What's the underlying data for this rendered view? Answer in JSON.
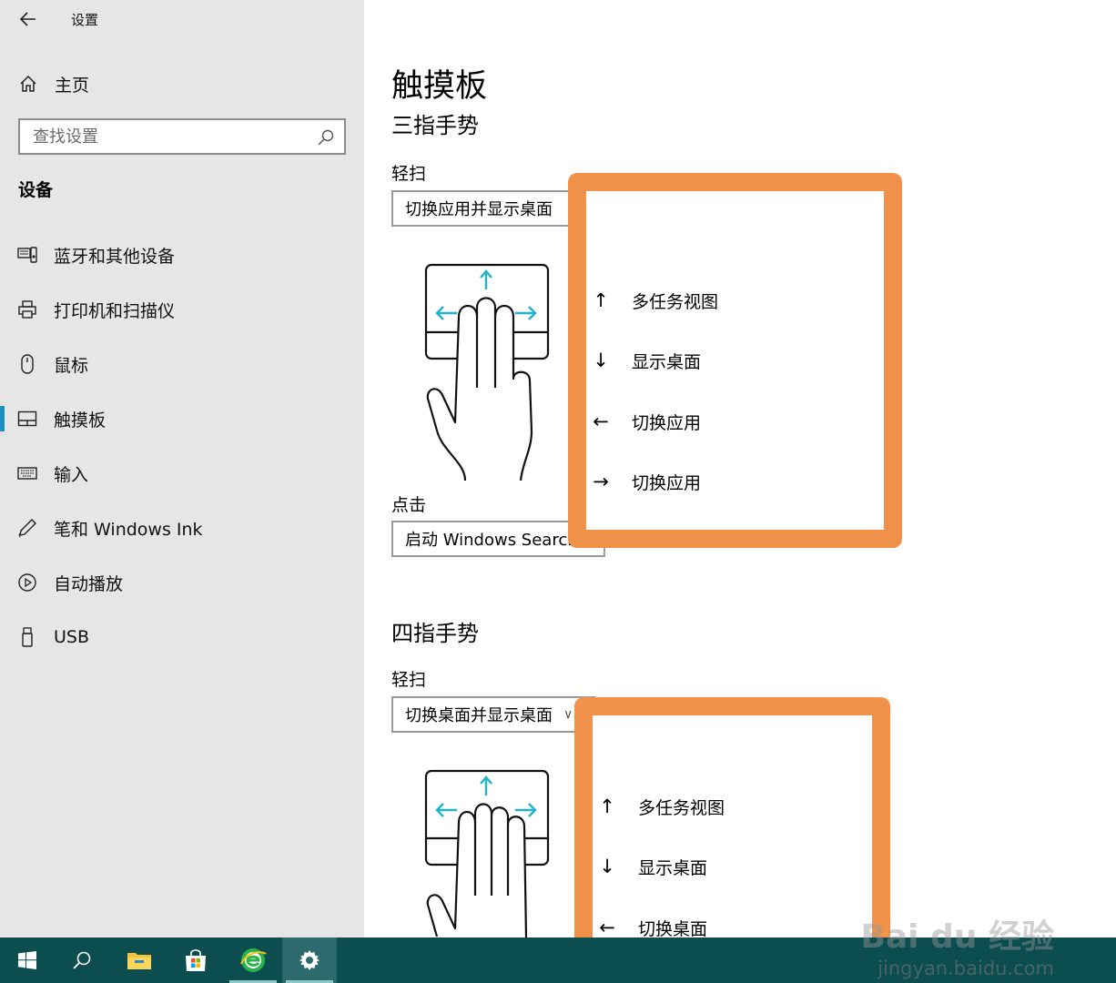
{
  "window": {
    "back_icon": "arrow-left-icon",
    "title": "设置"
  },
  "sidebar": {
    "home": {
      "icon": "home-icon",
      "label": "主页"
    },
    "search": {
      "placeholder": "查找设置",
      "icon": "search-icon"
    },
    "section_label": "设备",
    "items": [
      {
        "icon": "bluetooth-devices-icon",
        "label": "蓝牙和其他设备",
        "active": false
      },
      {
        "icon": "printer-icon",
        "label": "打印机和扫描仪",
        "active": false
      },
      {
        "icon": "mouse-icon",
        "label": "鼠标",
        "active": false
      },
      {
        "icon": "touchpad-icon",
        "label": "触摸板",
        "active": true
      },
      {
        "icon": "keyboard-icon",
        "label": "输入",
        "active": false
      },
      {
        "icon": "pen-icon",
        "label": "笔和 Windows Ink",
        "active": false
      },
      {
        "icon": "autoplay-icon",
        "label": "自动播放",
        "active": false
      },
      {
        "icon": "usb-icon",
        "label": "USB",
        "active": false
      }
    ],
    "accent": "#1a8fc2"
  },
  "main": {
    "title": "触摸板",
    "three_finger": {
      "heading": "三指手势",
      "swipe_label": "轻扫",
      "swipe_value": "切换应用并显示桌面",
      "tap_label": "点击",
      "tap_value": "启动 Windows Search",
      "swipe_options": [
        {
          "arrow": "↑",
          "label": "多任务视图"
        },
        {
          "arrow": "↓",
          "label": "显示桌面"
        },
        {
          "arrow": "←",
          "label": "切换应用"
        },
        {
          "arrow": "→",
          "label": "切换应用"
        }
      ]
    },
    "four_finger": {
      "heading": "四指手势",
      "swipe_label": "轻扫",
      "swipe_value": "切换桌面并显示桌面",
      "swipe_options": [
        {
          "arrow": "↑",
          "label": "多任务视图"
        },
        {
          "arrow": "↓",
          "label": "显示桌面"
        },
        {
          "arrow": "←",
          "label": "切换桌面"
        }
      ]
    },
    "highlight_color": "#f0924a",
    "gesture_accent": "#1fb4c9"
  },
  "taskbar": {
    "background": "#0c4d50",
    "buttons": [
      {
        "icon": "windows-start-icon"
      },
      {
        "icon": "search-icon"
      },
      {
        "icon": "file-explorer-icon"
      },
      {
        "icon": "store-icon"
      },
      {
        "icon": "browser-icon"
      },
      {
        "icon": "settings-gear-icon"
      }
    ]
  },
  "watermark": {
    "brand": "Bai du 经验",
    "url": "jingyan.baidu.com"
  }
}
